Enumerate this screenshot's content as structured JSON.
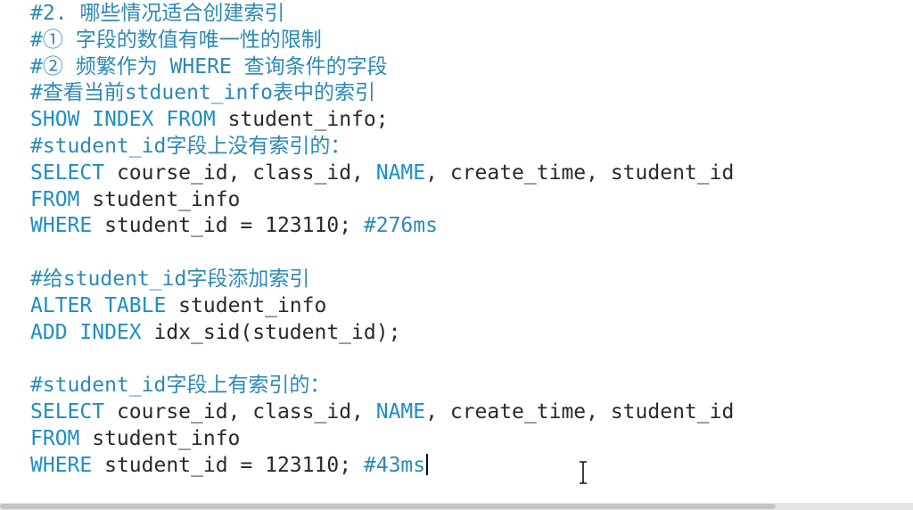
{
  "editor": {
    "lines": [
      {
        "tokens": [
          {
            "t": "#2. 哪些情况适合创建索引",
            "k": "comment"
          }
        ]
      },
      {
        "tokens": [
          {
            "t": "#① 字段的数值有唯一性的限制",
            "k": "comment"
          }
        ]
      },
      {
        "tokens": [
          {
            "t": "#② 频繁作为 WHERE 查询条件的字段",
            "k": "comment"
          }
        ]
      },
      {
        "tokens": [
          {
            "t": "#查看当前stduent_info表中的索引",
            "k": "comment"
          }
        ]
      },
      {
        "tokens": [
          {
            "t": "SHOW INDEX FROM",
            "k": "keyword"
          },
          {
            "t": " student_info;",
            "k": "plain"
          }
        ]
      },
      {
        "tokens": [
          {
            "t": "#student_id字段上没有索引的：",
            "k": "comment"
          }
        ]
      },
      {
        "tokens": [
          {
            "t": "SELECT",
            "k": "keyword"
          },
          {
            "t": " course_id, class_id, ",
            "k": "plain"
          },
          {
            "t": "NAME",
            "k": "keyword"
          },
          {
            "t": ", create_time, student_id",
            "k": "plain"
          }
        ]
      },
      {
        "tokens": [
          {
            "t": "FROM",
            "k": "keyword"
          },
          {
            "t": " student_info",
            "k": "plain"
          }
        ]
      },
      {
        "tokens": [
          {
            "t": "WHERE",
            "k": "keyword"
          },
          {
            "t": " student_id = 123110; ",
            "k": "plain"
          },
          {
            "t": "#276ms",
            "k": "comment"
          }
        ]
      },
      {
        "tokens": []
      },
      {
        "tokens": [
          {
            "t": "#给student_id字段添加索引",
            "k": "comment"
          }
        ]
      },
      {
        "tokens": [
          {
            "t": "ALTER TABLE",
            "k": "keyword"
          },
          {
            "t": " student_info",
            "k": "plain"
          }
        ]
      },
      {
        "tokens": [
          {
            "t": "ADD INDEX",
            "k": "keyword"
          },
          {
            "t": " idx_sid(student_id);",
            "k": "plain"
          }
        ]
      },
      {
        "tokens": []
      },
      {
        "tokens": [
          {
            "t": "#student_id字段上有索引的：",
            "k": "comment"
          }
        ]
      },
      {
        "tokens": [
          {
            "t": "SELECT",
            "k": "keyword"
          },
          {
            "t": " course_id, class_id, ",
            "k": "plain"
          },
          {
            "t": "NAME",
            "k": "keyword"
          },
          {
            "t": ", create_time, student_id",
            "k": "plain"
          }
        ]
      },
      {
        "tokens": [
          {
            "t": "FROM",
            "k": "keyword"
          },
          {
            "t": " student_info",
            "k": "plain"
          }
        ]
      },
      {
        "tokens": [
          {
            "t": "WHERE",
            "k": "keyword"
          },
          {
            "t": " student_id = 123110; ",
            "k": "plain"
          },
          {
            "t": "#43ms",
            "k": "comment"
          }
        ]
      }
    ],
    "caret_line": 17
  },
  "colors": {
    "comment": "#2d8ab4",
    "keyword": "#1e8fc2",
    "plain": "#2a2a2a",
    "background": "#ffffff",
    "scrollbar_track": "#e6e6e6",
    "scrollbar_thumb": "#c4c4c4"
  },
  "icons": {
    "mouse_cursor": "text-ibeam-cursor-icon"
  }
}
